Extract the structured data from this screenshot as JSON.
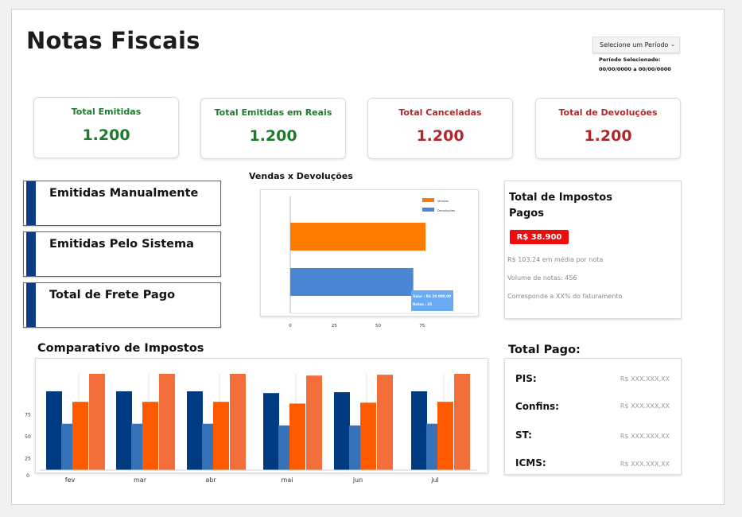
{
  "header": {
    "title": "Notas Fiscais",
    "period_select": "Selecione um Período",
    "period_label": "Período Selecionado:",
    "period_value": "00/00/0000 a 00/00/0000"
  },
  "kpis": [
    {
      "label": "Total Emitidas",
      "value": "1.200"
    },
    {
      "label": "Total Emitidas em Reais",
      "value": "1.200"
    },
    {
      "label": "Total Canceladas",
      "value": "1.200"
    },
    {
      "label": "Total de Devoluções",
      "value": "1.200"
    }
  ],
  "side_cards": [
    "Emitidas Manualmente",
    "Emitidas Pelo Sistema",
    "Total de Frete Pago"
  ],
  "colors": {
    "accent_navy": "#0d3d82",
    "orange": "#ff7a00",
    "blue": "#4a86d3",
    "green": "#1f7a2c",
    "red": "#b0282c",
    "badge_red": "#ee0c0c"
  },
  "taxes_paid": {
    "title": "Total de Impostos Pagos",
    "amount": "R$ 38.900",
    "notes": [
      "R$ 103.24 em média por nota",
      "Volume de notas: 456",
      "Corresponde a XX% do faturamento"
    ]
  },
  "total_paid": {
    "title": "Total Pago:",
    "rows": [
      {
        "label": "PIS:",
        "value": "R$ XXX.XXX,XX"
      },
      {
        "label": "Confins:",
        "value": "R$ XXX.XXX,XX"
      },
      {
        "label": "ST:",
        "value": "R$ XXX.XXX,XX"
      },
      {
        "label": "ICMS:",
        "value": "R$ XXX.XXX,XX"
      }
    ]
  },
  "chart_data": [
    {
      "type": "bar",
      "orientation": "horizontal",
      "title": "Vendas x Devoluções",
      "categories": [
        "Vendas",
        "Devoluções"
      ],
      "values": [
        77,
        70
      ],
      "colors": [
        "#ff7a00",
        "#4a86d3"
      ],
      "xticks": [
        0,
        25,
        50,
        75
      ],
      "xlim": [
        0,
        105
      ],
      "legend": "top-right",
      "tooltip": {
        "line1": "Valor : R$ 20.000,00",
        "line2": "Notas : 25"
      }
    },
    {
      "type": "bar",
      "title": "Comparativo de Impostos",
      "categories": [
        "fev",
        "mar",
        "abr",
        "mai",
        "jun",
        "jul"
      ],
      "series": [
        {
          "color": "#003a80",
          "values": [
            90,
            90,
            90,
            88,
            89,
            90
          ]
        },
        {
          "color": "#3672b8",
          "values": [
            53,
            53,
            53,
            51,
            51,
            53
          ]
        },
        {
          "color": "#ff5a00",
          "values": [
            78,
            78,
            78,
            76,
            77,
            78
          ]
        },
        {
          "color": "#f26e3a",
          "values": [
            110,
            110,
            110,
            108,
            109,
            110
          ]
        }
      ],
      "yticks": [
        0,
        25,
        50,
        75
      ],
      "ylim": [
        0,
        110
      ]
    }
  ]
}
